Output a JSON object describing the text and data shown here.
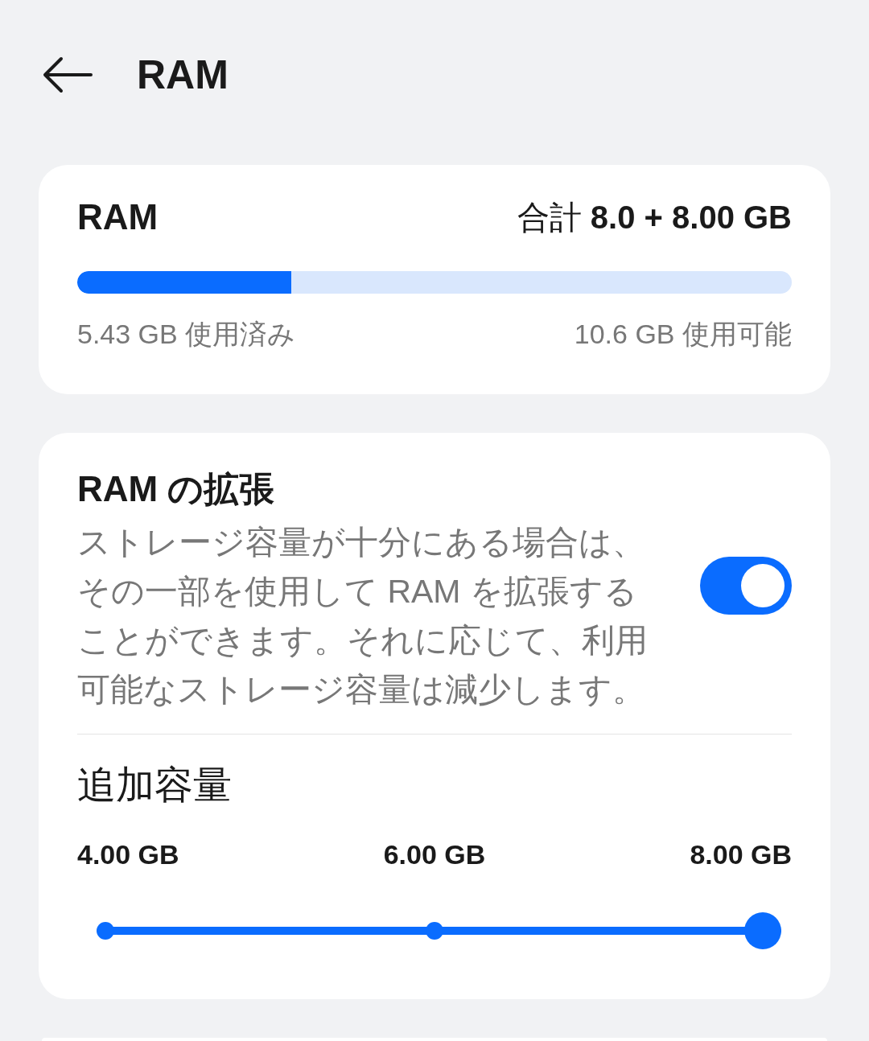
{
  "header": {
    "title": "RAM"
  },
  "usage_card": {
    "title": "RAM",
    "total": "合計 **8.0 + 8.00 GB**",
    "level": 0.3,
    "used": "5.43 GB 使用済み",
    "available": "10.6 GB 使用可能"
  },
  "expansion_card": {
    "title": "RAM の拡張",
    "description": "ストレージ容量が十分にある場合は、その一部を使用して RAM を拡張することができます。それに応じて、利用可能なストレージ容量は減少します。",
    "on": true,
    "extra_capacity": {
      "title": "追加容量",
      "labels": [
        "4.00 GB",
        "6.00 GB",
        "8.00 GB"
      ],
      "level": 1
    }
  }
}
